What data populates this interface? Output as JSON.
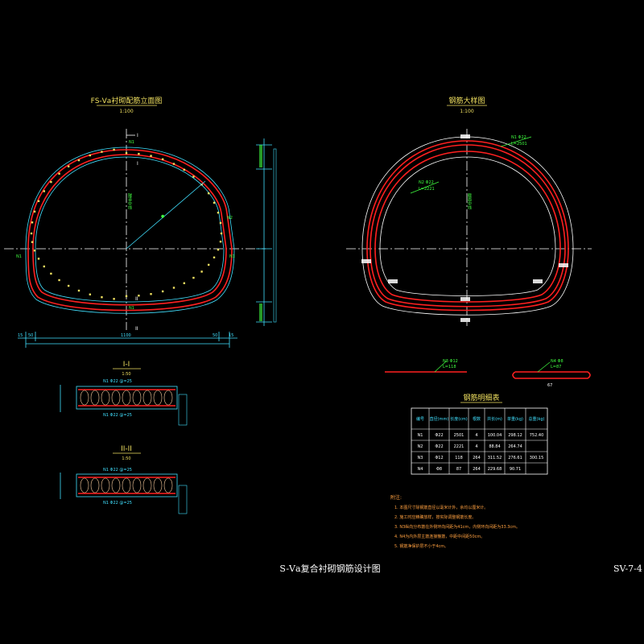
{
  "drawing": {
    "main_title": "S-Ⅴa复合衬砌钢筋设计图",
    "sheet_number": "SV-7-4"
  },
  "left_view": {
    "title": "FS-Ⅴa衬砌配筋立面图",
    "scale": "1:100",
    "section_mark_I": "I",
    "section_mark_II": "II",
    "centerline_label": "隧道中线",
    "labels": {
      "n1_top": "N1",
      "n1_left": "N1",
      "n1_right": "N1",
      "n2_right": "N2",
      "n1_bottom": "N1",
      "dim_total": "1100",
      "dim_left1": "15",
      "dim_left2": "50",
      "dim_right1": "50",
      "dim_right2": "15"
    }
  },
  "right_view": {
    "title": "钢筋大样图",
    "scale": "1:100",
    "n1_label": "N1 Φ22",
    "n1_length": "L=2501",
    "n2_label": "N2 Φ22",
    "n2_length": "L=2221",
    "vertical_label": "截面中线",
    "n3_label": "N3 Φ12",
    "n3_length": "L=118",
    "n4_label": "N4 Φ8",
    "n4_length": "L=87",
    "n4_dim": "67"
  },
  "section_I": {
    "title": "I-I",
    "scale": "1:50",
    "top_label": "N1  Φ22 @=25",
    "bottom_label": "N1  Φ22 @=25",
    "side_label": "N3 Φ12"
  },
  "section_II": {
    "title": "II-II",
    "scale": "1:50",
    "top_label": "N1  Φ22 @=25",
    "bottom_label": "N1  Φ22 @=25",
    "side_label": "N4 Φ8"
  },
  "table": {
    "title": "钢筋明细表",
    "headers": [
      "编号",
      "直径(mm)",
      "长度(cm)",
      "根数",
      "共长(m)",
      "单重(kg)",
      "总重(kg)"
    ],
    "rows": [
      [
        "N1",
        "Φ22",
        "2501",
        "4",
        "100.04",
        "298.12",
        "752.40"
      ],
      [
        "N2",
        "Φ22",
        "2221",
        "4",
        "88.84",
        "264.74",
        "",
        ""
      ],
      [
        "N3",
        "Φ12",
        "118",
        "264",
        "311.52",
        "276.61",
        "300.15"
      ],
      [
        "N4",
        "Φ8",
        "87",
        "264",
        "229.68",
        "90.71",
        "",
        ""
      ]
    ],
    "merged_total": "300.15"
  },
  "notes": {
    "title": "附注:",
    "lines": [
      "1. 本图尺寸除钢筋直径以毫米计外，余均以厘米计。",
      "2. 施工时应精确放样，按实际调整钢筋长度。",
      "3. N3纵向分布筋在外侧环向间距为41cm，内侧环向间距为33.3cm。",
      "4. N4为内外层主筋连接箍筋，中距中间距50cm。",
      "5. 钢筋净保护层不小于4cm。"
    ]
  }
}
